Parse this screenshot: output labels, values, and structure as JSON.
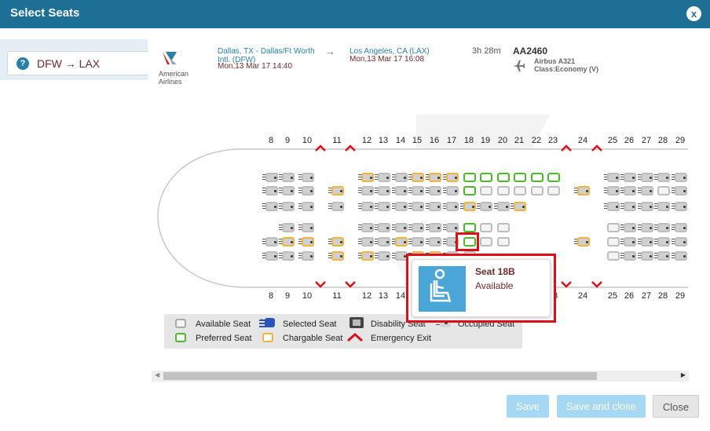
{
  "dialog": {
    "title": "Select Seats",
    "close_label": "x"
  },
  "route_tab": {
    "label": "DFW → LAX"
  },
  "flight": {
    "airline": "American Airlines",
    "departure_city": "Dallas, TX - Dallas/Ft Worth Intl. (DFW)",
    "departure_time": "Mon,13 Mar 17 14:40",
    "arrow": "→",
    "arrival_city": "Los Angeles, CA (LAX)",
    "arrival_time": "Mon,13 Mar 17 16:08",
    "duration": "3h 28m",
    "flight_number": "AA2460",
    "aircraft": "Airbus A321",
    "cabin_class": "Class:Economy (V)"
  },
  "seatmap": {
    "rows": [
      "8",
      "9",
      "10",
      "11",
      "12",
      "13",
      "14",
      "15",
      "16",
      "17",
      "18",
      "19",
      "20",
      "21",
      "22",
      "23",
      "24",
      "25",
      "26",
      "27",
      "28",
      "29"
    ]
  },
  "legend": {
    "available": "Available Seat",
    "selected": "Selected Seat",
    "disability": "Disability Seat",
    "occupied": "Occupied Seat",
    "preferred": "Preferred Seat",
    "chargeable": "Chargable Seat",
    "exit": "Emergency Exit"
  },
  "tooltip": {
    "title": "Seat 18B",
    "status": "Available"
  },
  "buttons": {
    "save": "Save",
    "save_close": "Save and close",
    "close": "Close"
  },
  "colors": {
    "header": "#1e6f96",
    "preferred": "#4aba2a",
    "chargeable": "#f0b441",
    "exit": "#d8111b",
    "highlight": "#d8111b"
  }
}
